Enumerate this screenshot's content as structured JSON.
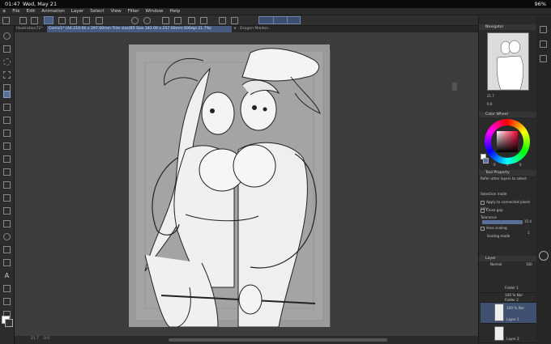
{
  "status": {
    "time": "01:47",
    "date": "Wed, May 21",
    "battery": "96%"
  },
  "menu": [
    "File",
    "Edit",
    "Animation",
    "Layer",
    "Select",
    "View",
    "Filter",
    "Window",
    "Help"
  ],
  "tabs": [
    {
      "label": "Illustration72*"
    },
    {
      "label": "Comic1* (A4 210.00 x 297.00mm Trim size(B5 Size 182.00 x 257.00mm 600dpi 21.7%)"
    },
    {
      "label": "Dragon Maiden..."
    }
  ],
  "navigator": {
    "title": "Navigator",
    "zoom": "21.7",
    "angle": "0.0"
  },
  "color_wheel": {
    "title": "Color Wheel",
    "h": "0",
    "s": "0",
    "v": "0"
  },
  "tool_property": {
    "title": "Tool Property",
    "tool_name": "Refer other layers to select",
    "selection_mode": "Selection mode",
    "apply_connected": "Apply to connected pixels only",
    "close_gap": "Close gap",
    "tolerance_label": "Tolerance",
    "tolerance_value": "15.4",
    "area_scaling": "Area scaling",
    "area_scaling_value": "1",
    "scaling_mode": "Scaling mode"
  },
  "layer": {
    "title": "Layer",
    "blend": "Normal",
    "opacity": "100",
    "items": [
      {
        "name": "Folder 1",
        "pct": ""
      },
      {
        "name": "Folder 2",
        "pct": "100 % Nor"
      },
      {
        "name": "Layer 1",
        "pct": "100 % Nor"
      },
      {
        "name": "Layer 2",
        "pct": ""
      }
    ]
  },
  "bottom": {
    "zoom": "21.7",
    "angle": "0.0"
  },
  "colors": {
    "accent": "#4a5f86",
    "panel": "#2a2a2a",
    "canvas_bg": "#3d3d3d"
  }
}
